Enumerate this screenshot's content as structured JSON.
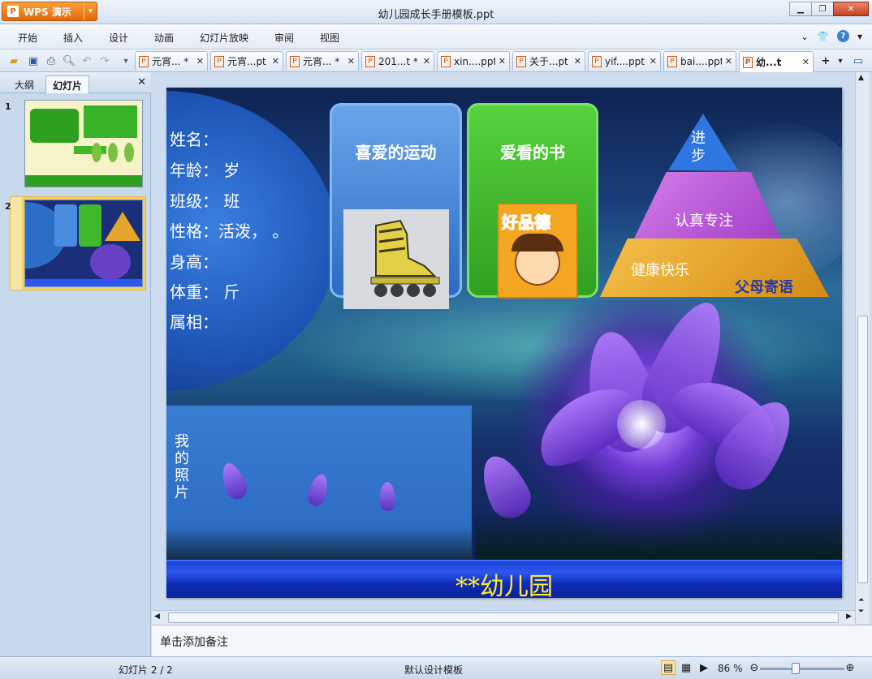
{
  "app": {
    "button_label": "WPS 演示",
    "window_title": "幼儿园成长手册模板.ppt"
  },
  "menu": {
    "items": [
      "开始",
      "插入",
      "设计",
      "动画",
      "幻灯片放映",
      "审阅",
      "视图"
    ]
  },
  "tabs": [
    {
      "label": "元宵... *"
    },
    {
      "label": "元宵...pt"
    },
    {
      "label": "元宵... *"
    },
    {
      "label": "201...t *"
    },
    {
      "label": "xin....ppt"
    },
    {
      "label": "关于...pt"
    },
    {
      "label": "yif....ppt"
    },
    {
      "label": "bai....ppt"
    },
    {
      "label": "幼...t"
    }
  ],
  "left_panel": {
    "tabs": [
      "大纲",
      "幻灯片"
    ],
    "slides": [
      "1",
      "2"
    ]
  },
  "slide": {
    "info_lines": [
      "姓名：",
      "年龄：  岁",
      "班级：  班",
      "性格：活泼，  。",
      "身高：",
      "体重：  斤",
      "属相："
    ],
    "photo_label": "我的照片",
    "card_sport": "喜爱的运动",
    "card_book": "爱看的书",
    "book_cover_text": "好品德",
    "pyramid": {
      "top": "进步",
      "mid": "认真专注",
      "bottom": "健康快乐",
      "caption": "父母寄语"
    },
    "banner_text": "**幼儿园"
  },
  "notes": {
    "placeholder": "单击添加备注"
  },
  "status": {
    "slide_position": "幻灯片 2 / 2",
    "design_template": "默认设计模板",
    "zoom_level": "86 %"
  },
  "colors": {
    "accent_orange": "#e26a0a",
    "banner_text": "#ffeb34",
    "sport_card": "#4a8ce0",
    "book_card": "#3fb82a",
    "pyramid_top": "#2f76e0",
    "pyramid_mid": "#b656d8",
    "pyramid_bottom": "#e5a52c"
  }
}
